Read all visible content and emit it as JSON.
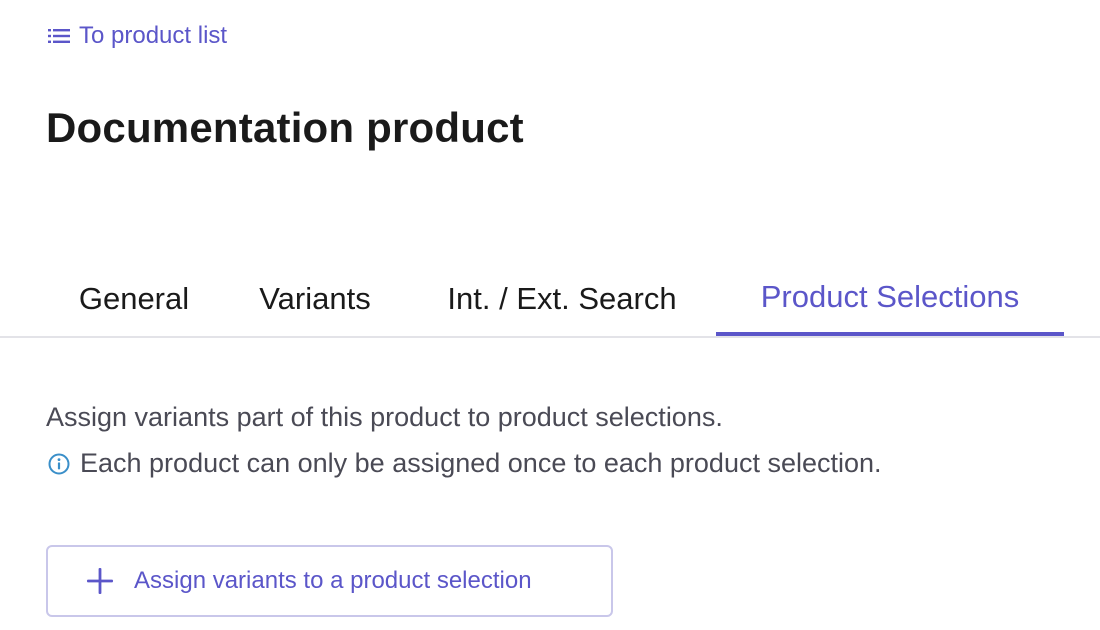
{
  "nav": {
    "back_label": "To product list",
    "back_icon": "list-icon"
  },
  "page": {
    "title": "Documentation product"
  },
  "tabs": [
    {
      "label": "General",
      "active": false
    },
    {
      "label": "Variants",
      "active": false
    },
    {
      "label": "Int. / Ext. Search",
      "active": false
    },
    {
      "label": "Product Selections",
      "active": true
    }
  ],
  "content": {
    "description": "Assign variants part of this product to product selections.",
    "info_icon": "info-icon",
    "info_text": "Each product can only be assigned once to each product selection.",
    "assign_button_label": "Assign variants to a product selection",
    "assign_button_icon": "plus-icon"
  },
  "colors": {
    "accent": "#5b56c9",
    "info_icon": "#3a8fc9",
    "text_primary": "#1a1a1a",
    "text_secondary": "#4a4a55",
    "divider": "#e3e3e8",
    "button_border": "#c9c7ea"
  }
}
